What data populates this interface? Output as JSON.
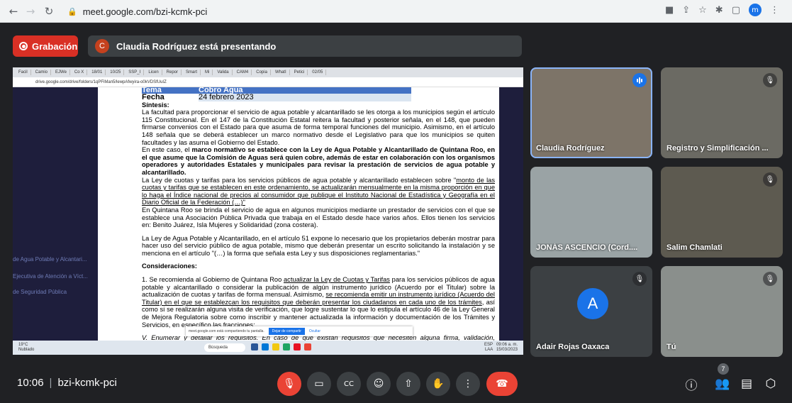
{
  "browser": {
    "url": "meet.google.com/bzi-kcmk-pci",
    "profile_initial": "m"
  },
  "recording": {
    "label": "Grabación"
  },
  "presenting": {
    "initial": "C",
    "text": "Claudia Rodríguez está presentando"
  },
  "shared_screen": {
    "tabs": [
      "Facil",
      "Camio",
      "EJWe",
      "Co X",
      "18/01",
      "10/25",
      "SSP_I",
      "Licen",
      "Repor",
      "Smart",
      "Mi",
      "Valida",
      "CAM4",
      "Copia",
      "WhatI",
      "Petici",
      "02/05"
    ],
    "url": "drive.google.com/drive/folders/1qPFiMan5/lewpAfwyira-o0kVDSfUuIZ",
    "left_items": [
      "de Agua Potable y Alcantari...",
      "Ejecutiva de Atención a Víct...",
      "de Seguridad Pública"
    ],
    "doc": {
      "tema_label": "Tema",
      "tema_value": "Cobro Agua",
      "fecha_label": "Fecha",
      "fecha_value": "24 febrero 2023",
      "sintesis_label": "Síntesis:",
      "p1": "La facultad para proporcionar el servicio de agua potable y alcantarillado se les otorga a los municipios según el artículo 115 Constitucional. En el 147 de la Constitución Estatal reitera la facultad y posterior señala, en el 148, que pueden firmarse convenios con el Estado para que asuma de forma temporal funciones del municipio. Asimismo, en el artículo 148 señala que se deberá establecer un marco normativo desde el Legislativo para que los municipios se quiten facultades y las asuma el Gobierno del Estado.",
      "p2_a": "En este caso, el ",
      "p2_b": "marco normativo se establece con la Ley de Agua Potable y Alcantarillado de Quintana Roo, en el que asume que la Comisión de Aguas será quien cobre, además de estar en colaboración con los organismos operadores y autoridades Estatales y municipales para revisar la prestación de servicios de agua potable y alcantarillado.",
      "p3_a": "La Ley de cuotas y tarifas para los servicios públicos de agua potable y alcantarillado establecen sobre \"",
      "p3_b": "monto de las cuotas y tarifas que se establecen en este ordenamiento, se actualizarán mensualmente en la misma proporción en que lo haga el Índice nacional de precios al consumidor que publique el Instituto Nacional de Estadística y Geografía en el Diario Oficial de la Federación (…)\"",
      "p4": "En Quintana Roo se brinda el servicio de agua en algunos municipios mediante un prestador de servicios con el que se establece una Asociación Pública Privada que trabaja en el Estado desde hace varios años. Ellos tienen los servicios en: Benito Juárez, Isla Mujeres y Solidaridad (zona costera).",
      "p5": "La Ley de Agua Potable y Alcantarillado, en el artículo 51 expone lo necesario que los propietarios deberán mostrar para hacer uso del servicio público de agua potable, mismo que deberán presentar un escrito solicitando la instalación y se menciona en el artículo \"(…) la forma que señala esta Ley y sus disposiciones reglamentarias.\"",
      "consideraciones_label": "Consideraciones:",
      "c1_a": "1. Se recomienda al Gobierno de Quintana Roo ",
      "c1_b": "actualizar la Ley de Cuotas y Tarifas",
      "c1_c": " para los servicios públicos de agua potable y alcantarillado o considerar la publicación de algún instrumento jurídico (Acuerdo por el Titular) sobre la actualización de cuotas y tarifas de forma mensual. Asimismo, ",
      "c1_d": "se recomienda emitir un instrumento jurídico (Acuerdo del Titular) en el que se establezcan los requisitos que deberán presentar los ciudadanos en cada uno de los trámites",
      "c1_e": ", así como si se realizarán alguna visita de verificación, que logre sustentar lo que lo estipula el artículo 46 de la Ley General de Mejora Regulatoria sobre como inscribir y mantener actualizada la información y documentación de los Trámites y Servicios, en específico las fracciones:",
      "c2": "V. Enumerar y detallar los requisitos. En caso de que existan requisitos que necesiten alguna firma, validación, certificación, autorización o visto bueno de un tercero, se deberá señalar la persona o empresa que lo emita. En caso de que el Trámite o Servicio que se esté inscribiendo incluya como requisitos la realización de Trámites o Servicios adicionales, deberá de identificar plenamente los mismos, señalando además el Sujeto Obligado ante quien se realiza;"
    },
    "share_bar": {
      "text": "meet.google.com está compartiendo tu pantalla.",
      "stop": "Dejar de compartir",
      "hide": "Ocultar"
    },
    "taskbar": {
      "temp": "19°C",
      "weather": "Nublado",
      "search": "Búsqueda",
      "lang": "ESP",
      "region": "LAA",
      "time": "09:06 a. m.",
      "date": "15/03/2023"
    }
  },
  "participants": [
    {
      "name": "Claudia Rodríguez",
      "state": "speaking"
    },
    {
      "name": "Registro y Simplificación ...",
      "state": "muted"
    },
    {
      "name": "JONÁS ASCENCIO (Cord....",
      "state": "none"
    },
    {
      "name": "Salim Chamlati",
      "state": "muted"
    },
    {
      "name": "Adair Rojas Oaxaca",
      "state": "muted",
      "initial": "A"
    },
    {
      "name": "Tú",
      "state": "muted"
    }
  ],
  "meeting": {
    "time": "10:06",
    "code": "bzi-kcmk-pci",
    "participant_count": "7"
  },
  "icons": {
    "mic_off": "mic-off-icon",
    "camera": "camera-icon",
    "captions": "captions-icon",
    "emoji": "emoji-icon",
    "present": "present-icon",
    "hand": "raise-hand-icon",
    "more": "more-vert-icon",
    "end_call": "end-call-icon"
  },
  "colors": {
    "background": "#202124",
    "end_call": "#ea4335",
    "accent": "#1a73e8"
  }
}
